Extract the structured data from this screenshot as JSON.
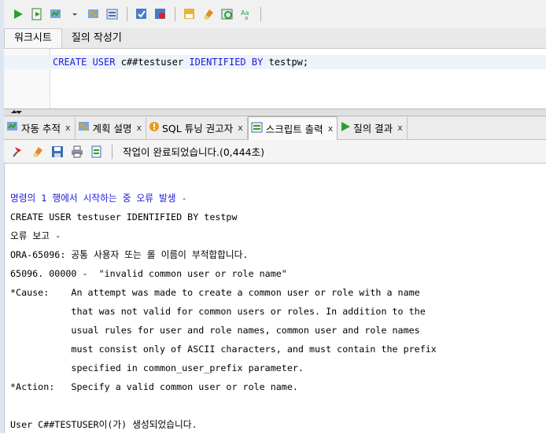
{
  "editor": {
    "tabs": [
      "워크시트",
      "질의 작성기"
    ],
    "code_line": {
      "t1": "CREATE USER ",
      "t2": "c##testuser",
      "t3": " IDENTIFIED BY ",
      "t4": "testpw",
      "t5": ";"
    }
  },
  "output_tabs": [
    {
      "label": "자동 추적",
      "close": "x"
    },
    {
      "label": "계획 설명",
      "close": "x"
    },
    {
      "label": "SQL 튜닝 권고자",
      "close": "x"
    },
    {
      "label": "스크립트 출력",
      "close": "x"
    },
    {
      "label": "질의 결과",
      "close": "x"
    }
  ],
  "output_toolbar": {
    "status": "작업이 완료되었습니다.(0,444초)"
  },
  "output_lines": [
    "명령의 1 행에서 시작하는 중 오류 발생 -",
    "CREATE USER testuser IDENTIFIED BY testpw",
    "오류 보고 -",
    "ORA-65096: 공통 사용자 또는 롤 이름이 부적합합니다.",
    "65096. 00000 -  \"invalid common user or role name\"",
    "*Cause:    An attempt was made to create a common user or role with a name",
    "           that was not valid for common users or roles. In addition to the",
    "           usual rules for user and role names, common user and role names",
    "           must consist only of ASCII characters, and must contain the prefix",
    "           specified in common_user_prefix parameter.",
    "*Action:   Specify a valid common user or role name.",
    "",
    "User C##TESTUSER이(가) 생성되었습니다."
  ]
}
